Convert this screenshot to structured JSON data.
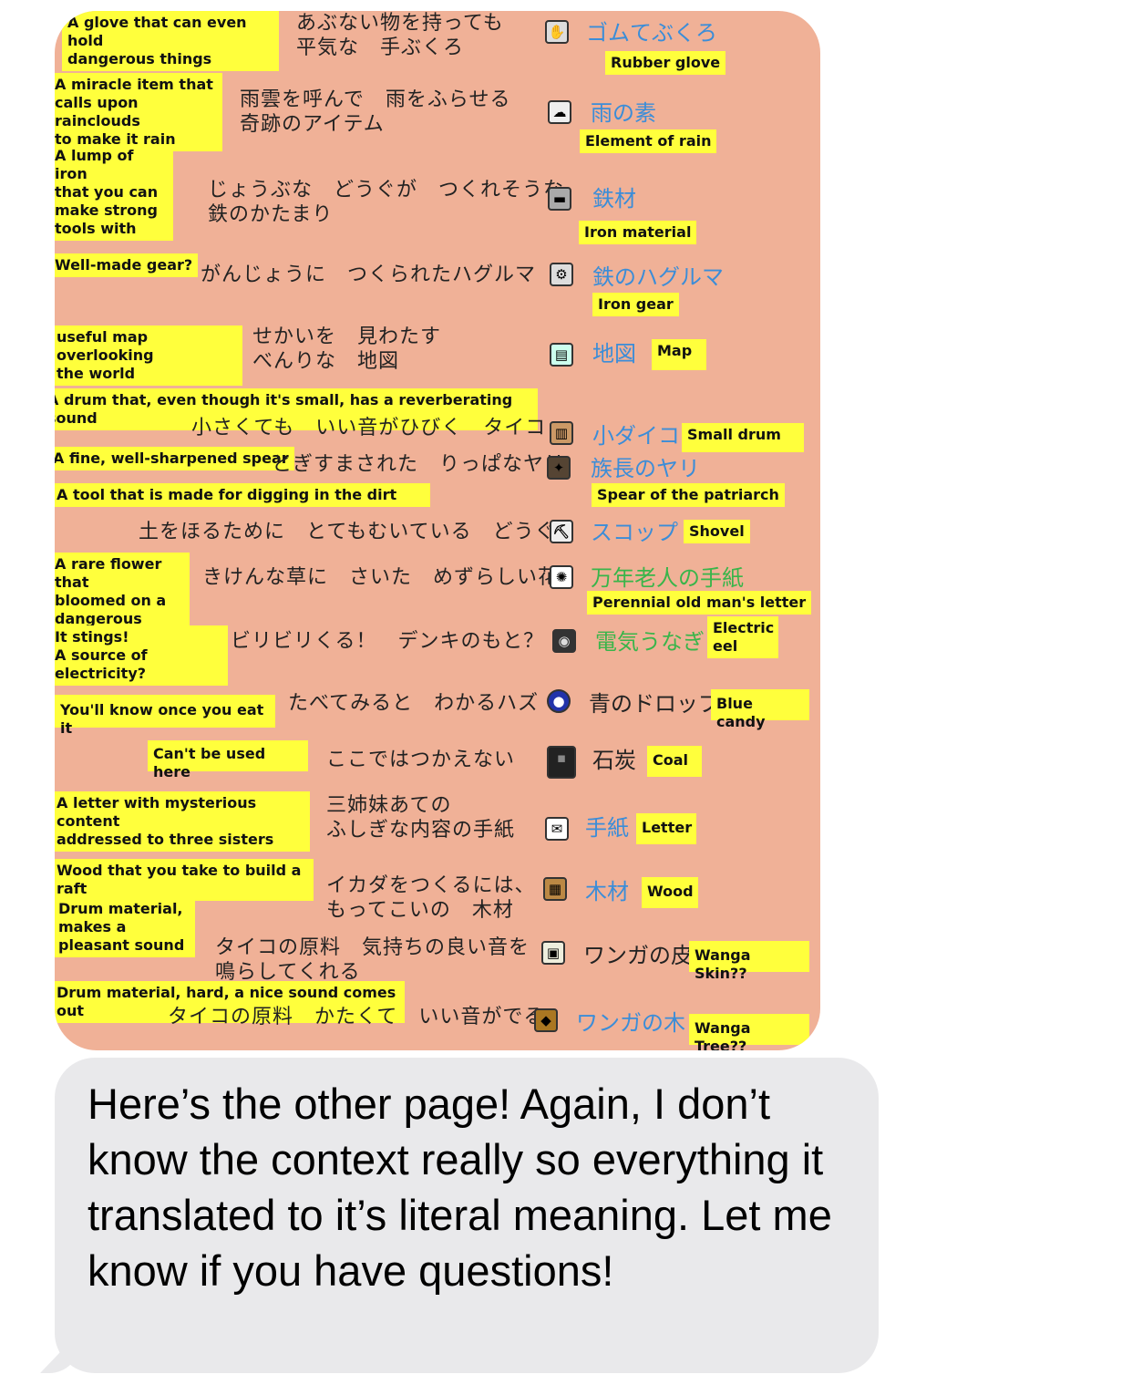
{
  "entries": [
    {
      "en": "A glove that can even hold\ndangerous things",
      "jp": "あぶない物を持っても\n平気な　手ぶくろ",
      "name": "ゴムてぶくろ",
      "name_en": "Rubber glove",
      "icon": "glove-icon"
    },
    {
      "en": "A miracle item that\ncalls upon rainclouds\nto make it rain",
      "jp": "雨雲を呼んで　雨をふらせる\n奇跡のアイテム",
      "name": "雨の素",
      "name_en": "Element of rain",
      "icon": "rain-icon"
    },
    {
      "en": "A lump of iron\nthat you can\nmake strong\ntools with",
      "jp": "じょうぶな　どうぐが　つくれそうな\n鉄のかたまり",
      "name": "鉄材",
      "name_en": "Iron material",
      "icon": "iron-icon"
    },
    {
      "en": "Well-made gear?",
      "jp": "がんじょうに　つくられたハグルマ",
      "name": "鉄のハグルマ",
      "name_en": "Iron gear",
      "icon": "gear-icon"
    },
    {
      "en": "useful map overlooking\nthe world",
      "jp": "せかいを　見わたす\nべんりな　地図",
      "name": "地図",
      "name_en": "Map",
      "icon": "map-icon"
    },
    {
      "en": "A drum that, even though it's small, has a reverberating sound",
      "jp": "小さくても　いい音がひびく　タイコ",
      "name": "小ダイコ",
      "name_en": "Small drum",
      "icon": "drum-icon"
    },
    {
      "en": "A fine, well-sharpened spear",
      "jp": "とぎすまされた　りっぱなヤリ",
      "name": "族長のヤリ",
      "name_en": "Spear of the patriarch",
      "icon": "spear-icon"
    },
    {
      "en": "A tool that is made for digging in the dirt",
      "jp": "土をほるために　とてもむいている　どうぐ",
      "name": "スコップ",
      "name_en": "Shovel",
      "icon": "shovel-icon"
    },
    {
      "en": "A rare flower that\nbloomed on a\ndangerous plant",
      "jp": "きけんな草に　さいた　めずらしい花",
      "name": "万年老人の手紙",
      "name_en": "Perennial old man's letter",
      "icon": "flower-icon"
    },
    {
      "en": "It stings!\nA source of electricity?",
      "jp": "ビリビリくる！　デンキのもと？",
      "name": "電気うなぎ",
      "name_en": "Electric\neel",
      "icon": "eel-icon"
    },
    {
      "en": "You'll know once you eat it",
      "jp": "たべてみると　わかるハズ",
      "name": "青のドロップ",
      "name_en": "Blue candy",
      "icon": "candy-icon"
    },
    {
      "en": "Can't be used here",
      "jp": "ここではつかえない",
      "name": "石炭",
      "name_en": "Coal",
      "icon": "coal-icon"
    },
    {
      "en": "A letter with mysterious content\naddressed to three sisters",
      "jp": "三姉妹あての\nふしぎな内容の手紙",
      "name": "手紙",
      "name_en": "Letter",
      "icon": "letter-icon"
    },
    {
      "en": "Wood that you take to build a raft",
      "jp": "イカダをつくるには、\nもってこいの　木材",
      "name": "木材",
      "name_en": "Wood",
      "icon": "wood-icon"
    },
    {
      "en": "Drum material,\nmakes a\npleasant sound",
      "jp": "タイコの原料　気持ちの良い音を\n鳴らしてくれる",
      "name": "ワンガの皮",
      "name_en": "Wanga Skin??",
      "icon": "skin-icon"
    },
    {
      "en": "Drum material, hard, a nice sound comes out",
      "jp": "タイコの原料　かたくて　いい音がでる",
      "name": "ワンガの木",
      "name_en": "Wanga Tree??",
      "icon": "tree-icon"
    }
  ],
  "message": {
    "text": "Here’s the other page! Again, I don’t know the context really so everything it translated to it’s literal meaning. Let me know if you have questions!"
  },
  "colors": {
    "image_bg": "#f0b197",
    "note_bg": "#ffff3c",
    "bubble_bg": "#e9e9eb",
    "name_blue": "#3b8dd8",
    "name_green": "#39b54a"
  }
}
